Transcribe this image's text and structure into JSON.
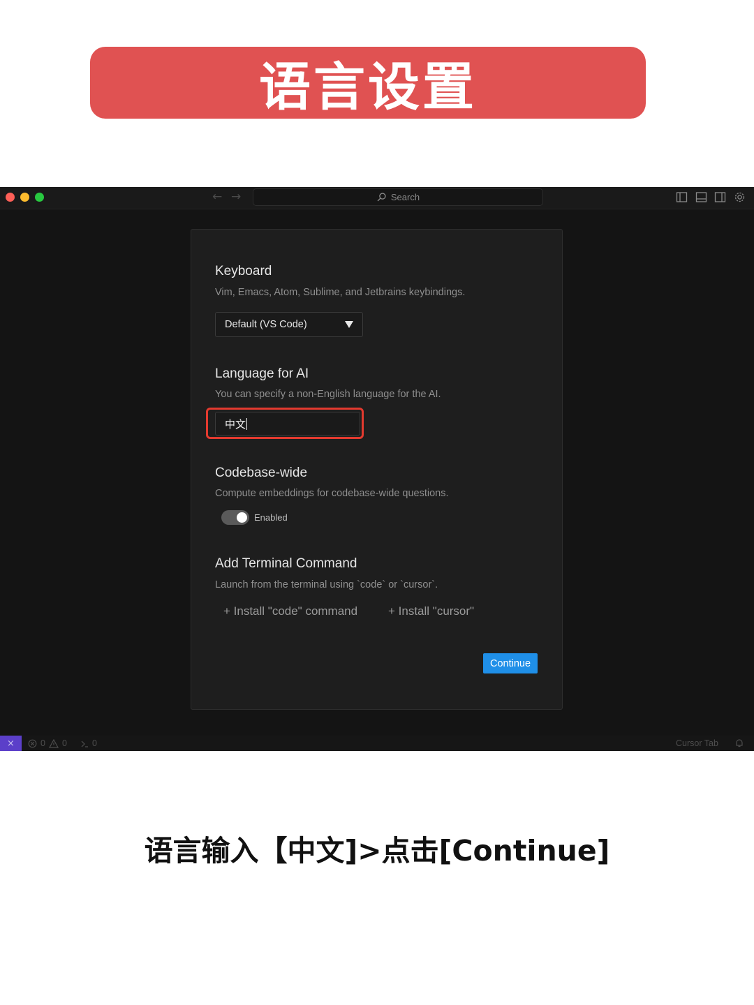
{
  "banner": {
    "title": "语言设置"
  },
  "window": {
    "search_placeholder": "Search",
    "back_arrow": "←",
    "forward_arrow": "→"
  },
  "settings": {
    "keyboard": {
      "title": "Keyboard",
      "description": "Vim, Emacs, Atom, Sublime, and Jetbrains keybindings.",
      "selected": "Default (VS Code)"
    },
    "language": {
      "title": "Language for AI",
      "description": "You can specify a non-English language for the AI.",
      "value": "中文"
    },
    "codebase": {
      "title": "Codebase-wide",
      "description": "Compute embeddings for codebase-wide questions.",
      "toggle_label": "Enabled",
      "enabled": true
    },
    "terminal": {
      "title": "Add Terminal Command",
      "description": "Launch from the terminal using `code` or `cursor`.",
      "install_code": "+ Install \"code\" command",
      "install_cursor": "+ Install \"cursor\""
    },
    "continue_label": "Continue"
  },
  "statusbar": {
    "remote_icon": "×",
    "errors": "0",
    "warnings": "0",
    "ports": "0",
    "cursor_tab": "Cursor Tab"
  },
  "colors": {
    "banner": "#e05252",
    "highlight": "#e33a2f",
    "continue_button": "#1f8fe8",
    "remote_button": "#5b3fc9"
  },
  "caption": "语言输入【中文]>点击[Continue]"
}
